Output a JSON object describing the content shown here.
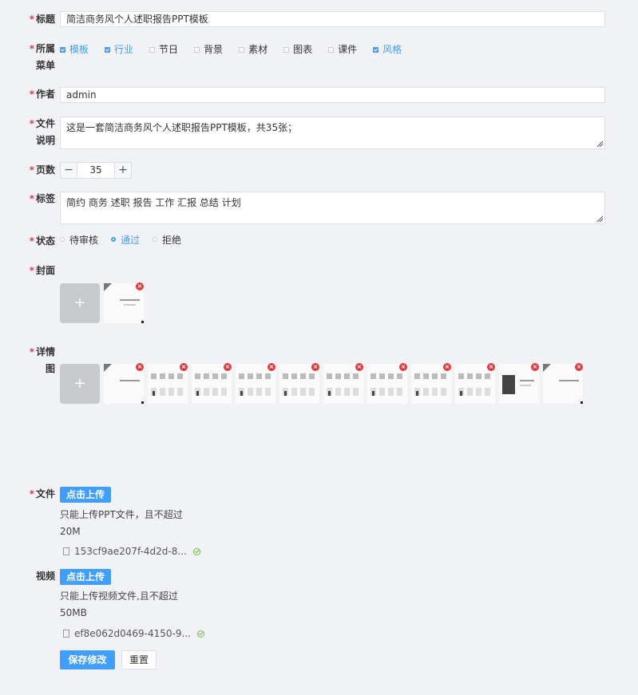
{
  "form": {
    "title": {
      "label": "标题",
      "value": "简洁商务风个人述职报告PPT模板"
    },
    "menu": {
      "label_line1": "所属",
      "label_line2": "菜单",
      "options": [
        {
          "label": "模板",
          "checked": true
        },
        {
          "label": "行业",
          "checked": true
        },
        {
          "label": "节日",
          "checked": false
        },
        {
          "label": "背景",
          "checked": false
        },
        {
          "label": "素材",
          "checked": false
        },
        {
          "label": "图表",
          "checked": false
        },
        {
          "label": "课件",
          "checked": false
        },
        {
          "label": "风格",
          "checked": true
        }
      ]
    },
    "author": {
      "label": "作者",
      "value": "admin"
    },
    "desc": {
      "label_line1": "文件",
      "label_line2": "说明",
      "value": "这是一套简洁商务风个人述职报告PPT模板，共35张；"
    },
    "pages": {
      "label": "页数",
      "value": "35",
      "minus": "−",
      "plus": "+"
    },
    "tags": {
      "label": "标签",
      "value": "简约 商务 述职 报告 工作 汇报 总结 计划"
    },
    "status": {
      "label": "状态",
      "options": [
        {
          "label": "待审核",
          "selected": false
        },
        {
          "label": "通过",
          "selected": true
        },
        {
          "label": "拒绝",
          "selected": false
        }
      ]
    },
    "cover": {
      "label": "封面",
      "add": "+",
      "remove": "×"
    },
    "detail": {
      "label_line1": "详情",
      "label_line2": "图",
      "add": "+",
      "remove": "×"
    },
    "file": {
      "label": "文件",
      "button": "点击上传",
      "tip": "只能上传PPT文件，且不超过20M",
      "filename": "153cf9ae207f-4d2d-8..."
    },
    "video": {
      "label": "视频",
      "button": "点击上传",
      "tip": "只能上传视频文件,且不超过50MB",
      "filename": "ef8e062d0469-4150-9..."
    },
    "actions": {
      "save": "保存修改",
      "reset": "重置"
    }
  },
  "colors": {
    "primary": "#409eff",
    "required": "#e4393c",
    "success": "#67c23a",
    "remove": "#e4393c"
  }
}
